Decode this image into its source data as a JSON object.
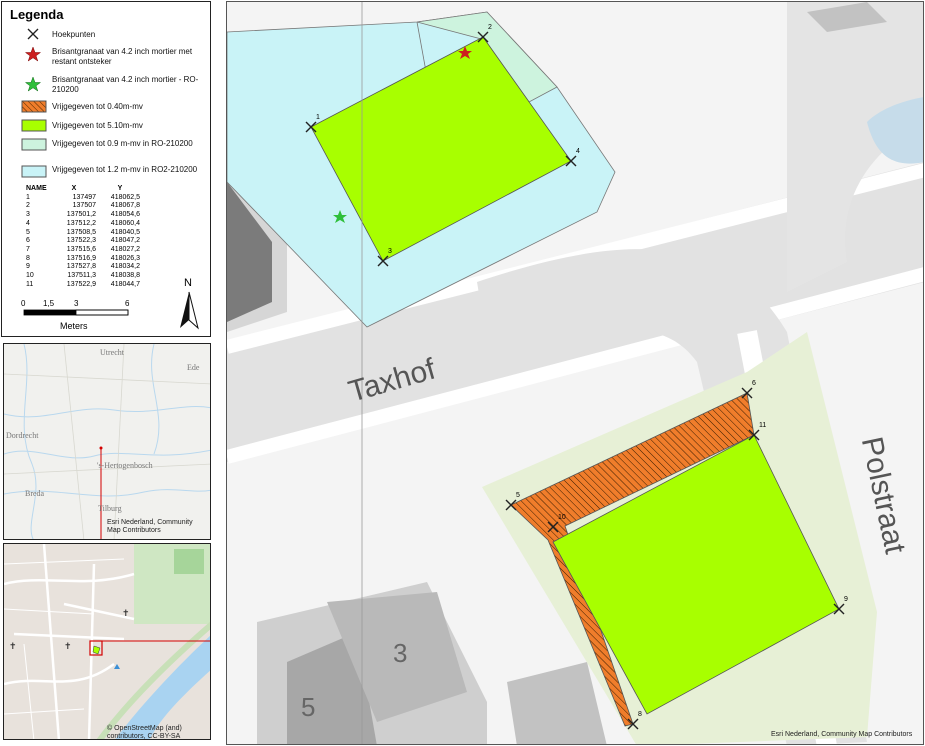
{
  "legend": {
    "title": "Legenda",
    "items": [
      {
        "label": "Hoekpunten",
        "icon": "x-marker-icon"
      },
      {
        "label": "Brisantgranaat van 4.2 inch mortier met restant ontsteker",
        "icon": "red-star-icon",
        "color": "#cc1f1f"
      },
      {
        "label": "Brisantgranaat van 4.2 inch mortier - RO-210200",
        "icon": "green-star-icon",
        "color": "#2fbf3a"
      },
      {
        "label": "Vrijgegeven tot 0.40m-mv",
        "color": "#f07d2b",
        "pattern": "hatched"
      },
      {
        "label": "Vrijgegeven tot 5.10m-mv",
        "color": "#a8ff00"
      },
      {
        "label": "Vrijgegeven tot 0.9 m-mv in RO-210200",
        "color": "#cdf3de"
      },
      {
        "label": "Vrijgegeven tot 1.2 m-mv in RO2-210200",
        "color": "#c9f3f7"
      }
    ],
    "table": {
      "headers": [
        "NAME",
        "X",
        "Y"
      ],
      "rows": [
        [
          "1",
          "137497",
          "418062,5"
        ],
        [
          "2",
          "137507",
          "418067,8"
        ],
        [
          "3",
          "137501,2",
          "418054,6"
        ],
        [
          "4",
          "137512,2",
          "418060,4"
        ],
        [
          "5",
          "137508,5",
          "418040,5"
        ],
        [
          "6",
          "137522,3",
          "418047,2"
        ],
        [
          "7",
          "137515,6",
          "418027,2"
        ],
        [
          "8",
          "137516,9",
          "418026,3"
        ],
        [
          "9",
          "137527,8",
          "418034,2"
        ],
        [
          "10",
          "137511,3",
          "418038,8"
        ],
        [
          "11",
          "137522,9",
          "418044,7"
        ]
      ]
    },
    "scale": {
      "ticks": [
        "0",
        "1,5",
        "3",
        "6"
      ],
      "unit": "Meters"
    },
    "north": "N"
  },
  "overview": {
    "places": [
      "Utrecht",
      "Ede",
      "Dordrecht",
      "'s-Hertogenbosch",
      "Breda",
      "Tilburg"
    ],
    "credit": "Esri Nederland, Community Map Contributors"
  },
  "locator": {
    "credit": "© OpenStreetMap (and) contributors, CC-BY-SA"
  },
  "mainmap": {
    "streets": [
      "Taxhof",
      "Polstraat"
    ],
    "house_numbers": [
      "3",
      "5"
    ],
    "points": [
      "1",
      "2",
      "3",
      "4",
      "5",
      "6",
      "8",
      "9",
      "10",
      "11"
    ],
    "credit": "Esri Nederland, Community Map Contributors"
  }
}
